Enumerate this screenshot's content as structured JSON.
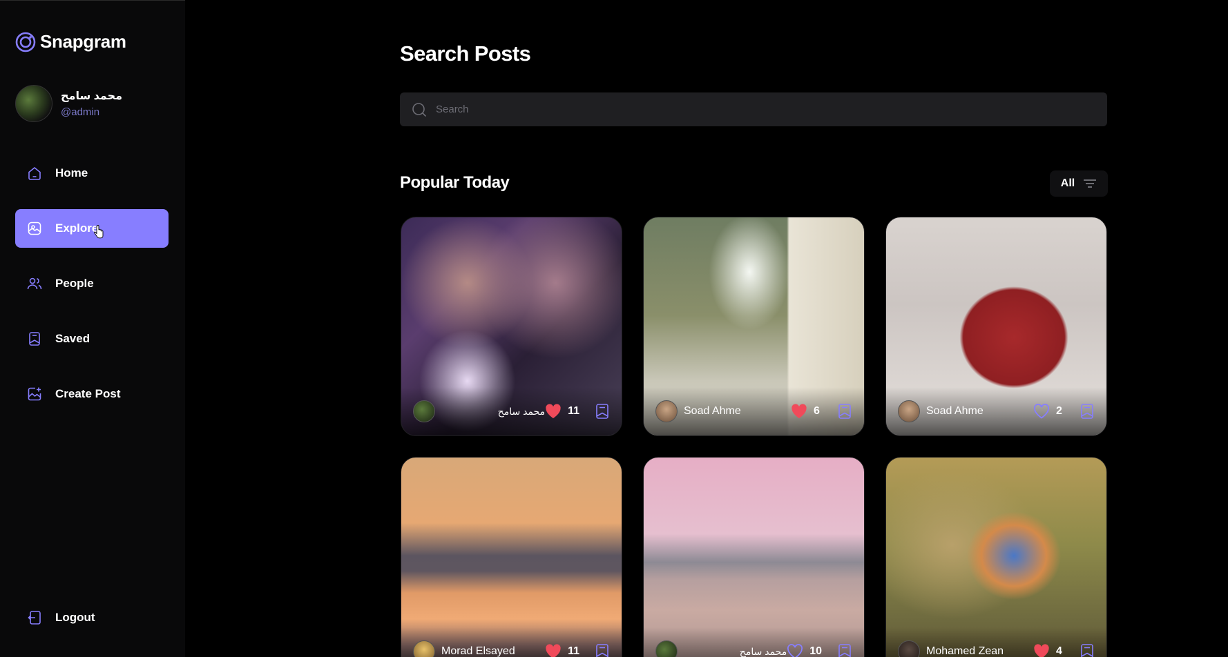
{
  "app": {
    "name": "Snapgram",
    "accent": "#877eff",
    "handle_color": "#7b79c9"
  },
  "user": {
    "name": "محمد سامح",
    "handle": "@admin"
  },
  "sidebar": {
    "items": [
      {
        "label": "Home",
        "icon": "home-icon"
      },
      {
        "label": "Explore",
        "icon": "explore-icon",
        "active": true
      },
      {
        "label": "People",
        "icon": "people-icon"
      },
      {
        "label": "Saved",
        "icon": "saved-icon"
      },
      {
        "label": "Create Post",
        "icon": "create-post-icon"
      }
    ],
    "logout_label": "Logout"
  },
  "main": {
    "title": "Search Posts",
    "search": {
      "placeholder": "Search",
      "value": ""
    },
    "section_title": "Popular Today",
    "filter_label": "All"
  },
  "posts": [
    {
      "author": "محمد سامح",
      "likes": "11",
      "liked": true
    },
    {
      "author": "Soad Ahme",
      "likes": "6",
      "liked": true
    },
    {
      "author": "Soad Ahme",
      "likes": "2",
      "liked": false
    },
    {
      "author": "Morad Elsayed",
      "likes": "11",
      "liked": true
    },
    {
      "author": "محمد سامح",
      "likes": "10",
      "liked": false
    },
    {
      "author": "Mohamed Zean",
      "likes": "4",
      "liked": true
    }
  ],
  "colors": {
    "heart_filled": "#f04a5a",
    "icon_purple": "#877eff"
  }
}
